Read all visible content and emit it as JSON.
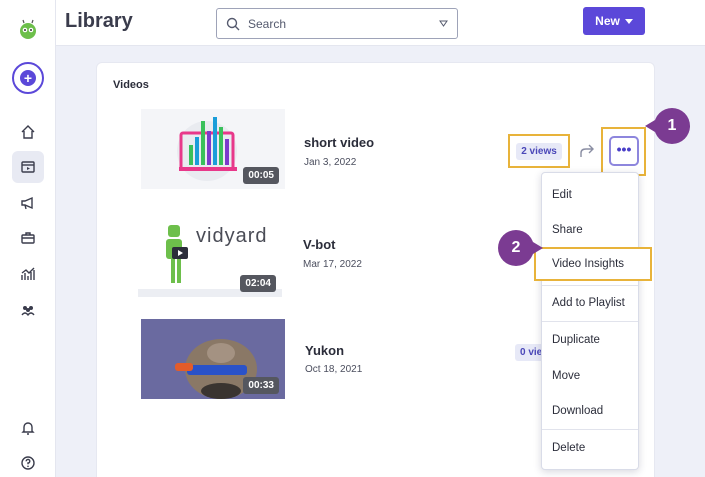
{
  "header": {
    "title": "Library",
    "search_placeholder": "Search",
    "new_label": "New"
  },
  "sidebar": {
    "items": [
      {
        "icon": "home-icon"
      },
      {
        "icon": "library-icon",
        "active": true
      },
      {
        "icon": "megaphone-icon"
      },
      {
        "icon": "briefcase-icon"
      },
      {
        "icon": "analytics-icon"
      },
      {
        "icon": "team-icon"
      }
    ],
    "bottom": [
      {
        "icon": "bell-icon"
      },
      {
        "icon": "help-icon"
      }
    ]
  },
  "panel": {
    "title": "Videos",
    "videos": [
      {
        "name": "short video",
        "date": "Jan 3, 2022",
        "duration": "00:05",
        "views": "2 views"
      },
      {
        "name": "V-bot",
        "date": "Mar 17, 2022",
        "duration": "02:04"
      },
      {
        "name": "Yukon",
        "date": "Oct 18, 2021",
        "duration": "00:33",
        "views": "0 views"
      }
    ],
    "thumb_text": "vidyard"
  },
  "callouts": {
    "one": "1",
    "two": "2"
  },
  "more_label": "•••",
  "menu": {
    "items": [
      "Edit",
      "Share",
      "Video Insights",
      "Add to Playlist",
      "Duplicate",
      "Move",
      "Download",
      "Delete"
    ]
  },
  "colors": {
    "accent": "#5b48d9",
    "highlight": "#e8b33a",
    "callout": "#7b3b92"
  }
}
